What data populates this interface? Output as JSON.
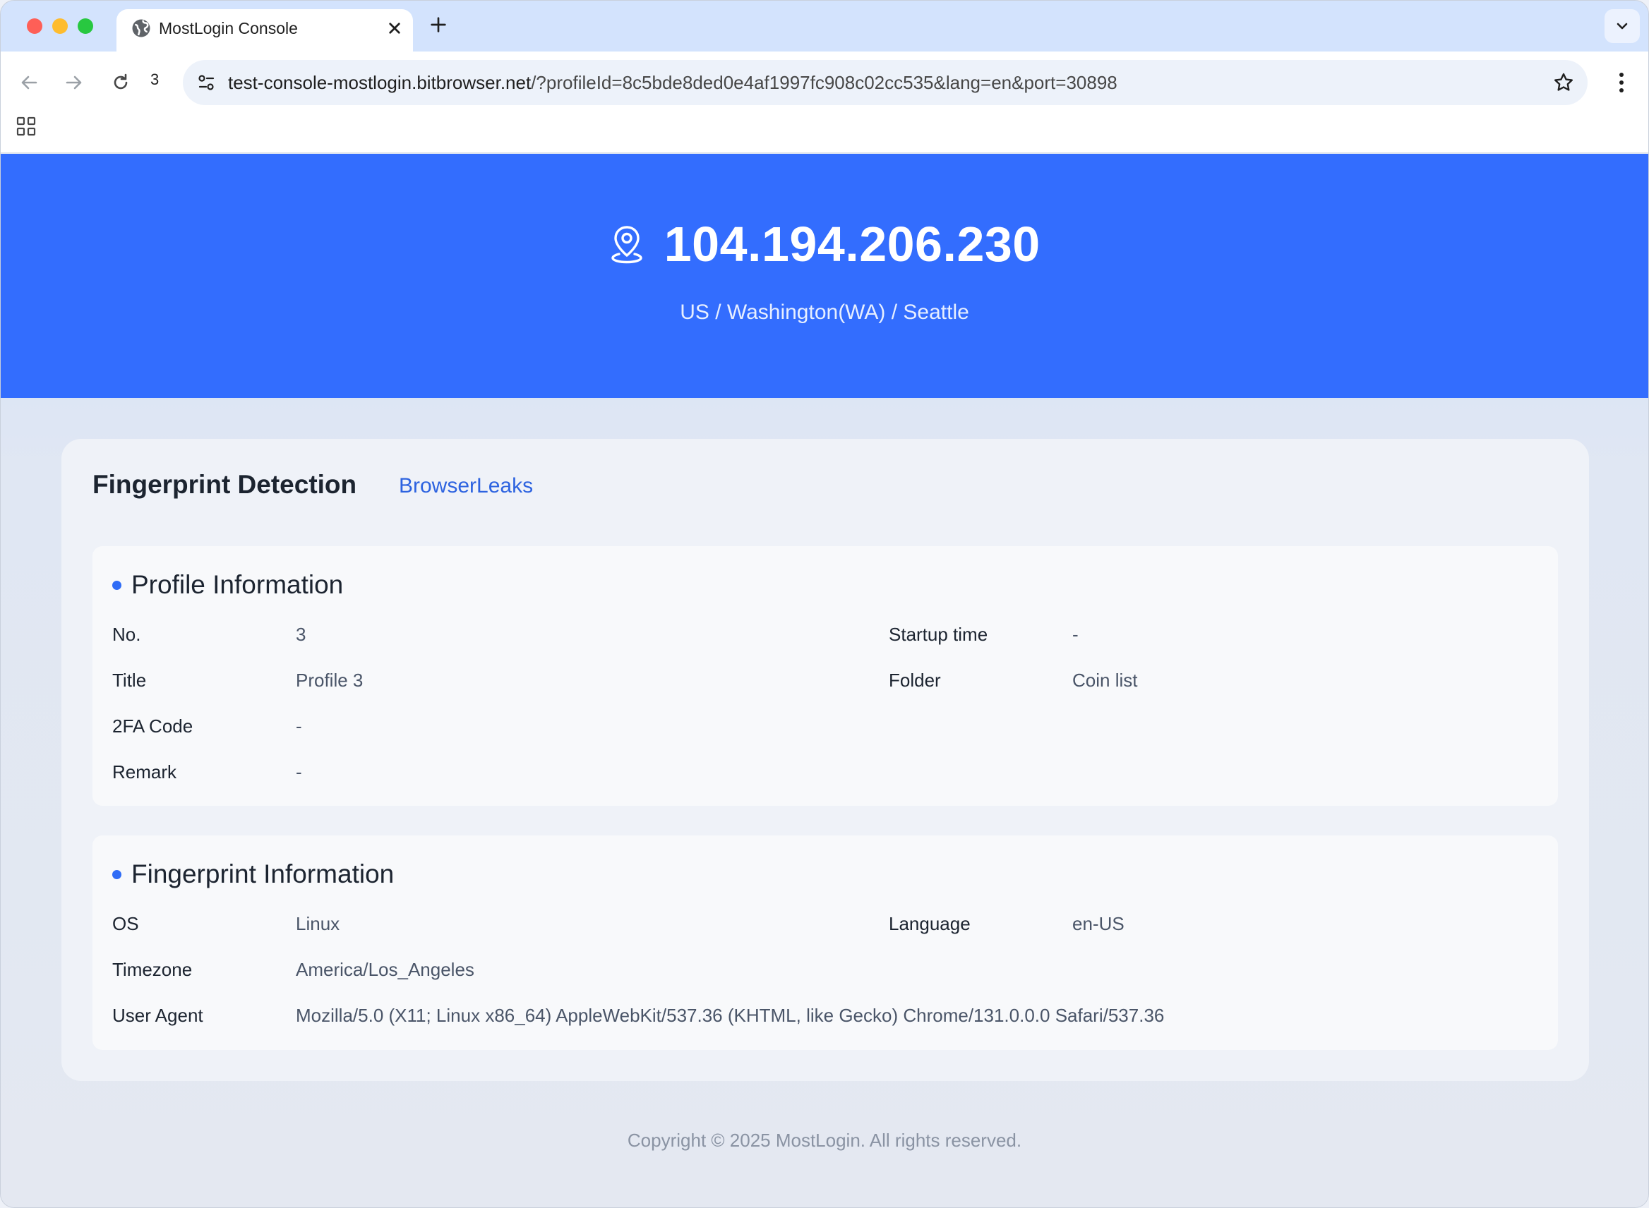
{
  "browser": {
    "tab_title": "MostLogin Console",
    "tab_count": "3",
    "url_host": "test-console-mostlogin.bitbrowser.net",
    "url_rest": "/?profileId=8c5bde8ded0e4af1997fc908c02cc535&lang=en&port=30898",
    "icons": [
      "globe-icon",
      "close-icon",
      "plus-icon",
      "chevron-down-icon",
      "back-icon",
      "forward-icon",
      "reload-icon",
      "site-info-icon",
      "star-icon",
      "kebab-icon",
      "apps-icon"
    ]
  },
  "hero": {
    "ip": "104.194.206.230",
    "location": "US / Washington(WA) / Seattle",
    "icon": "location-pin-icon",
    "background": "#336dfe"
  },
  "card": {
    "title": "Fingerprint Detection",
    "link": "BrowserLeaks"
  },
  "profile": {
    "title": "Profile Information",
    "rows": [
      {
        "label": "No.",
        "value": "3"
      },
      {
        "label": "Startup time",
        "value": "-"
      },
      {
        "label": "Title",
        "value": "Profile 3"
      },
      {
        "label": "Folder",
        "value": "Coin list"
      },
      {
        "label": "2FA Code",
        "value": "-"
      },
      {
        "label": "Remark",
        "value": "-"
      }
    ]
  },
  "fingerprint": {
    "title": "Fingerprint Information",
    "rows": [
      {
        "label": "OS",
        "value": "Linux"
      },
      {
        "label": "Language",
        "value": "en-US"
      },
      {
        "label": "Timezone",
        "value": "America/Los_Angeles"
      },
      {
        "label": "User Agent",
        "value": "Mozilla/5.0 (X11; Linux x86_64) AppleWebKit/537.36 (KHTML, like Gecko) Chrome/131.0.0.0 Safari/537.36"
      }
    ]
  },
  "footer": {
    "copyright": "Copyright © 2025 MostLogin. All rights reserved."
  }
}
